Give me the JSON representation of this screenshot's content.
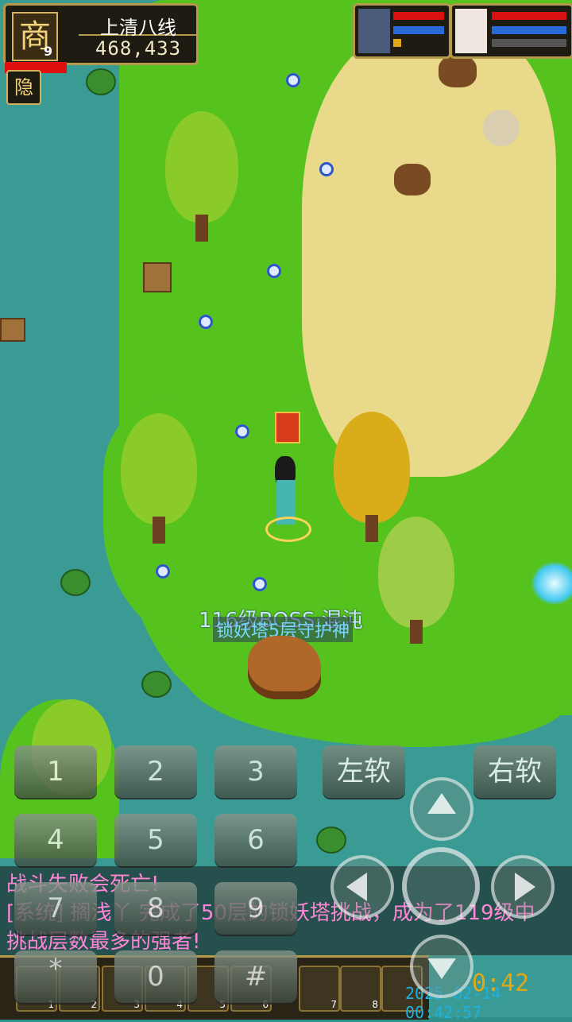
{
  "hud": {
    "emblem_char": "商",
    "level": "9",
    "server_line": "上清八线",
    "gold": "468,433",
    "hide_label": "隐"
  },
  "scene": {
    "npc_label": "116级BOSS·混沌",
    "npc_subtitle": "锁妖塔5层守护神"
  },
  "keypad": {
    "left_soft": "左软",
    "right_soft": "右软",
    "keys": [
      "1",
      "2",
      "3",
      "4",
      "5",
      "6",
      "7",
      "8",
      "9",
      "*",
      "0",
      "#"
    ]
  },
  "messages": [
    {
      "text": "战斗失败会死亡!",
      "color": "#ff86d6"
    },
    {
      "text": "[系统] 搁浅丫 完成了50层的锁妖塔挑战，成为了119级中",
      "color": "#ff86d6"
    },
    {
      "text": "挑战层数最多的强者!",
      "color": "#ff86d6"
    }
  ],
  "toolbar": {
    "slot_numbers": [
      "1",
      "2",
      "3",
      "4",
      "5",
      "6",
      "7",
      "8"
    ],
    "clock": "0:42"
  },
  "timestamp": "2025-02-14 00:42:57",
  "colors": {
    "gold_border": "#b59a4c",
    "hp_red": "#e01010",
    "mp_blue": "#2a6ad8",
    "message_pink": "#ff86d6"
  }
}
